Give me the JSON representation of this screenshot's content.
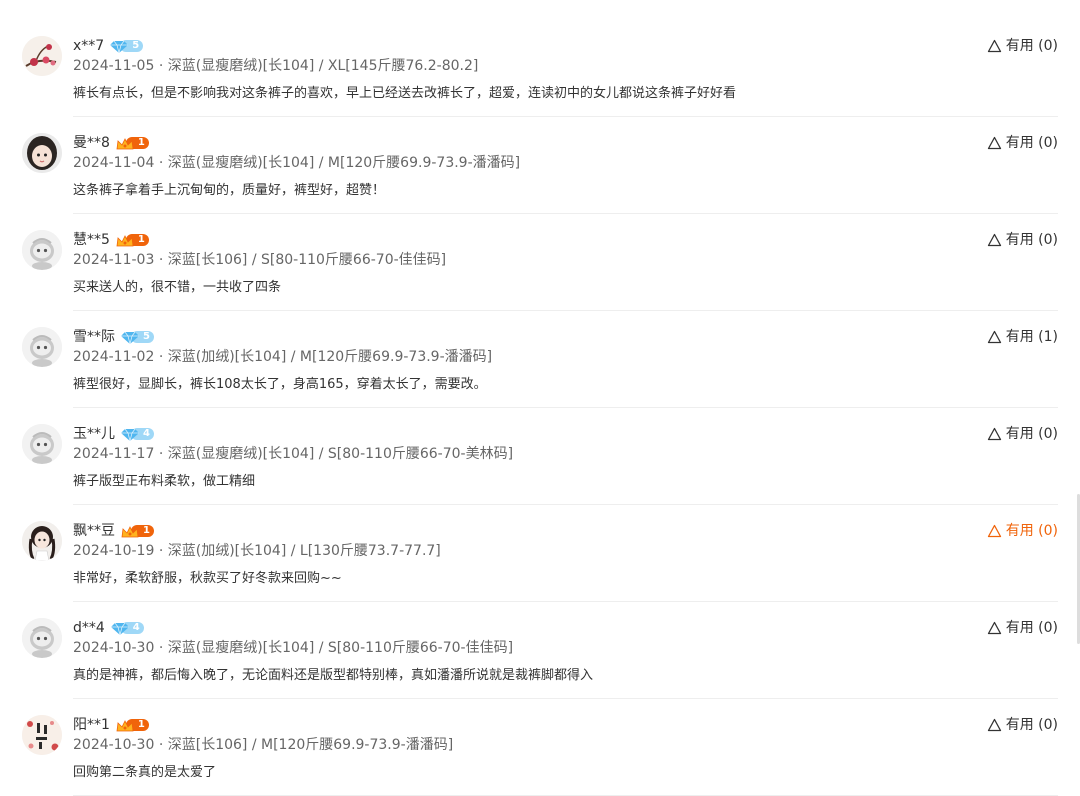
{
  "reviews": [
    {
      "user": "x**7",
      "level": "5",
      "level_type": "diamond",
      "date": "2024-11-05",
      "spec": "深蓝(显瘦磨绒)[长104] / XL[145斤腰76.2-80.2]",
      "content": "裤长有点长，但是不影响我对这条裤子的喜欢，早上已经送去改裤长了，超爱，连读初中的女儿都说这条裤子好好看",
      "helpful": "有用 (0)",
      "helpful_active": false,
      "avatar": "plum-blossom-avatar"
    },
    {
      "user": "曼**8",
      "level": "1",
      "level_type": "crown",
      "date": "2024-11-04",
      "spec": "深蓝(显瘦磨绒)[长104] / M[120斤腰69.9-73.9-潘潘码]",
      "content": "这条裤子拿着手上沉甸甸的，质量好，裤型好，超赞！",
      "helpful": "有用 (0)",
      "helpful_active": false,
      "avatar": "girl-avatar"
    },
    {
      "user": "慧**5",
      "level": "1",
      "level_type": "crown",
      "date": "2024-11-03",
      "spec": "深蓝[长106] / S[80-110斤腰66-70-佳佳码]",
      "content": "买来送人的，很不错，一共收了四条",
      "helpful": "有用 (0)",
      "helpful_active": false,
      "avatar": "default-avatar"
    },
    {
      "user": "雪**际",
      "level": "5",
      "level_type": "diamond",
      "date": "2024-11-02",
      "spec": "深蓝(加绒)[长104] / M[120斤腰69.9-73.9-潘潘码]",
      "content": "裤型很好，显脚长，裤长108太长了，身高165，穿着太长了，需要改。",
      "helpful": "有用 (1)",
      "helpful_active": false,
      "avatar": "default-avatar"
    },
    {
      "user": "玉**儿",
      "level": "4",
      "level_type": "diamond",
      "date": "2024-11-17",
      "spec": "深蓝(显瘦磨绒)[长104] / S[80-110斤腰66-70-美林码]",
      "content": "裤子版型正布料柔软，做工精细",
      "helpful": "有用 (0)",
      "helpful_active": false,
      "avatar": "default-avatar"
    },
    {
      "user": "飘**豆",
      "level": "1",
      "level_type": "crown",
      "date": "2024-10-19",
      "spec": "深蓝(加绒)[长104] / L[130斤腰73.7-77.7]",
      "content": "非常好，柔软舒服，秋款买了好冬款来回购~~",
      "helpful": "有用 (0)",
      "helpful_active": true,
      "avatar": "braids-girl-avatar"
    },
    {
      "user": "d**4",
      "level": "4",
      "level_type": "diamond",
      "date": "2024-10-30",
      "spec": "深蓝(显瘦磨绒)[长104] / S[80-110斤腰66-70-佳佳码]",
      "content": "真的是神裤，都后悔入晚了，无论面料还是版型都特别棒，真如潘潘所说就是裁裤脚都得入",
      "helpful": "有用 (0)",
      "helpful_active": false,
      "avatar": "default-avatar"
    },
    {
      "user": "阳**1",
      "level": "1",
      "level_type": "crown",
      "date": "2024-10-30",
      "spec": "深蓝[长106] / M[120斤腰69.9-73.9-潘潘码]",
      "content": "回购第二条真的是太爱了",
      "helpful": "有用 (0)",
      "helpful_active": false,
      "avatar": "calligraphy-avatar"
    }
  ],
  "colors": {
    "text": "#333333",
    "meta": "#666666",
    "accent": "#f0640b",
    "diamond": "#9fd8f7",
    "divider": "#eeeeee"
  }
}
